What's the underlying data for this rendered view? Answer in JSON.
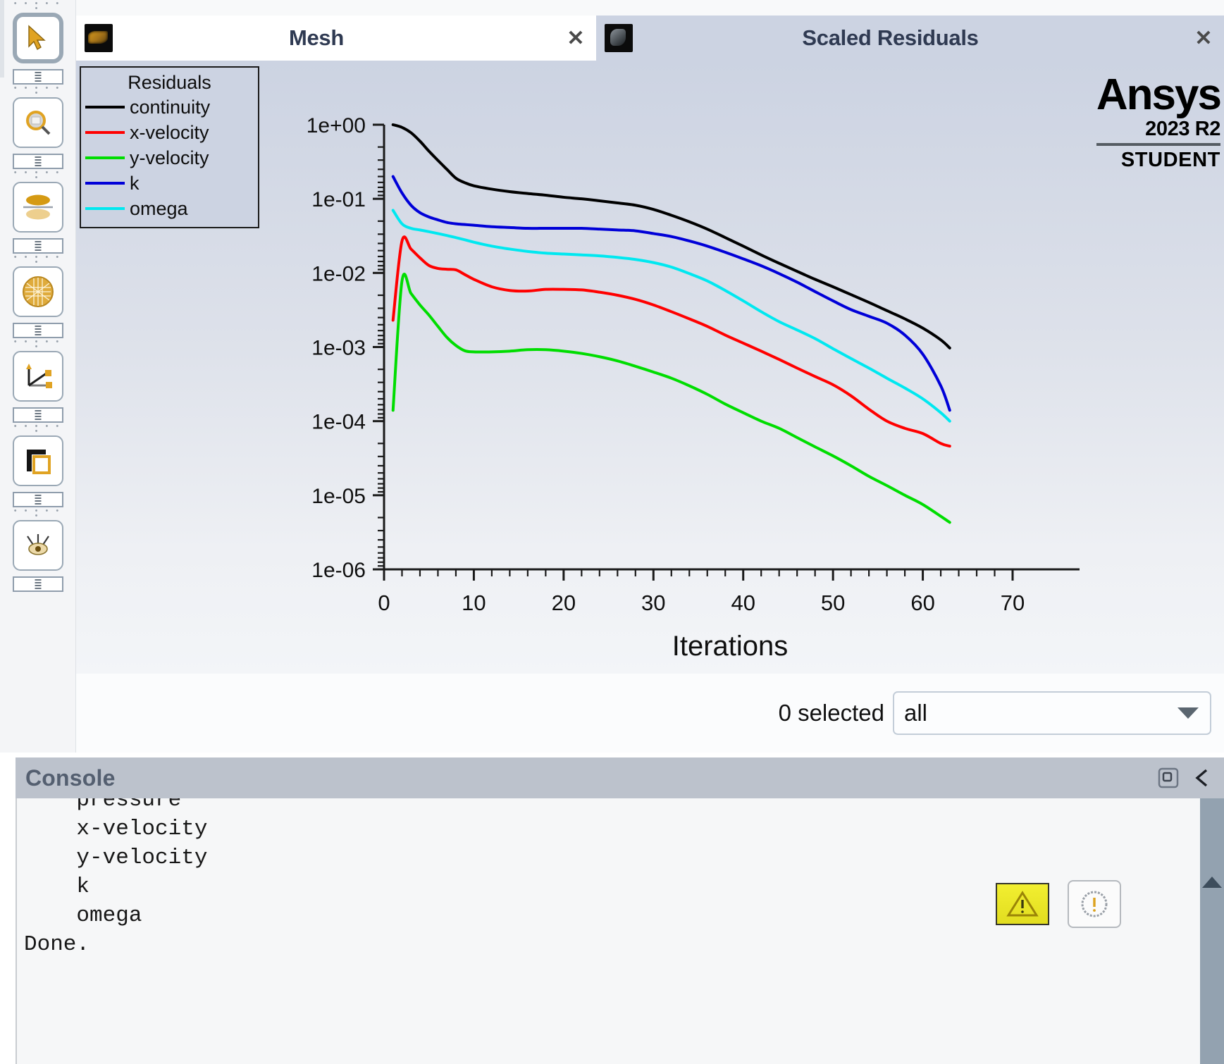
{
  "tabs": [
    {
      "label": "Mesh",
      "icon": "mesh-thumbnail-icon",
      "close_label": "✕",
      "active": false
    },
    {
      "label": "Scaled Residuals",
      "icon": "residuals-thumbnail-icon",
      "close_label": "✕",
      "active": true
    }
  ],
  "toolbar": {
    "items": [
      {
        "name": "select-cursor-tool",
        "icon": "cursor-arrow-icon"
      },
      {
        "name": "zoom-tool",
        "icon": "magnifier-icon"
      },
      {
        "name": "mirror-tool",
        "icon": "mirror-planes-icon"
      },
      {
        "name": "mesh-display-tool",
        "icon": "mesh-sphere-icon"
      },
      {
        "name": "axes-tool",
        "icon": "coordinate-axes-icon"
      },
      {
        "name": "copy-view-tool",
        "icon": "copy-layers-icon"
      },
      {
        "name": "view-tool",
        "icon": "eye-view-icon"
      }
    ]
  },
  "logo": {
    "brand": "Ansys",
    "version": "2023 R2",
    "edition": "STUDENT"
  },
  "legend": {
    "title": "Residuals",
    "entries": [
      {
        "label": "continuity",
        "color": "#000000"
      },
      {
        "label": "x-velocity",
        "color": "#ff0000"
      },
      {
        "label": "y-velocity",
        "color": "#00dd00"
      },
      {
        "label": "k",
        "color": "#0000d8"
      },
      {
        "label": "omega",
        "color": "#00e8f0"
      }
    ]
  },
  "selection": {
    "count_label": "0 selected",
    "value": "all",
    "arrow_icon": "chevron-down-icon"
  },
  "console": {
    "title": "Console",
    "popout_icon": "undock-window-icon",
    "collapse_icon": "chevron-left-icon",
    "warning_icon": "warning-triangle-icon",
    "info_icon": "info-circle-icon",
    "scroll_up_icon": "scroll-up-arrow-icon",
    "lines": [
      "    pressure",
      "    x-velocity",
      "    y-velocity",
      "    k",
      "    omega",
      "Done."
    ]
  },
  "chart_data": {
    "type": "line",
    "title": "Scaled Residuals",
    "xlabel": "Iterations",
    "ylabel": "",
    "yscale": "log",
    "xlim": [
      0,
      70
    ],
    "ylim": [
      1e-06,
      1
    ],
    "xticks": [
      0,
      10,
      20,
      30,
      40,
      50,
      60,
      70
    ],
    "yticks": [
      "1e+00",
      "1e-01",
      "1e-02",
      "1e-03",
      "1e-04",
      "1e-05",
      "1e-06"
    ],
    "grid": false,
    "legend_position": "top-left",
    "x": [
      1,
      2,
      3,
      4,
      5,
      6,
      7,
      8,
      9,
      10,
      12,
      14,
      16,
      18,
      20,
      22,
      24,
      26,
      28,
      30,
      32,
      34,
      36,
      38,
      40,
      42,
      44,
      46,
      48,
      50,
      52,
      54,
      56,
      58,
      60,
      62,
      63
    ],
    "series": [
      {
        "name": "continuity",
        "color": "#000000",
        "values": [
          1.0,
          0.92,
          0.78,
          0.6,
          0.44,
          0.33,
          0.25,
          0.19,
          0.165,
          0.15,
          0.135,
          0.125,
          0.118,
          0.112,
          0.105,
          0.1,
          0.094,
          0.088,
          0.082,
          0.072,
          0.06,
          0.049,
          0.039,
          0.03,
          0.023,
          0.0175,
          0.0135,
          0.0105,
          0.0082,
          0.0065,
          0.0051,
          0.004,
          0.0031,
          0.0024,
          0.0018,
          0.00125,
          0.00097
        ]
      },
      {
        "name": "x-velocity",
        "color": "#ff0000",
        "values": [
          0.0023,
          0.027,
          0.021,
          0.016,
          0.0126,
          0.0115,
          0.0112,
          0.011,
          0.0095,
          0.0082,
          0.0065,
          0.0058,
          0.0057,
          0.006,
          0.006,
          0.0059,
          0.0055,
          0.005,
          0.0044,
          0.0037,
          0.003,
          0.0024,
          0.0019,
          0.00145,
          0.00113,
          0.00088,
          0.00068,
          0.00052,
          0.0004,
          0.00031,
          0.00022,
          0.000145,
          0.0001,
          8e-05,
          6.8e-05,
          5e-05,
          4.6e-05
        ]
      },
      {
        "name": "y-velocity",
        "color": "#00dd00",
        "values": [
          0.00014,
          0.0078,
          0.0053,
          0.0037,
          0.0027,
          0.0019,
          0.00135,
          0.00105,
          0.00089,
          0.00086,
          0.00086,
          0.00088,
          0.00092,
          0.00092,
          0.00088,
          0.00082,
          0.00074,
          0.00065,
          0.00055,
          0.00046,
          0.00038,
          0.0003,
          0.00023,
          0.00017,
          0.00013,
          0.0001,
          8e-05,
          6e-05,
          4.5e-05,
          3.4e-05,
          2.5e-05,
          1.8e-05,
          1.35e-05,
          1e-05,
          7.5e-06,
          5.2e-06,
          4.3e-06
        ]
      },
      {
        "name": "k",
        "color": "#0000d8",
        "values": [
          0.2,
          0.12,
          0.082,
          0.065,
          0.057,
          0.052,
          0.048,
          0.046,
          0.045,
          0.044,
          0.042,
          0.041,
          0.04,
          0.04,
          0.04,
          0.04,
          0.039,
          0.038,
          0.037,
          0.034,
          0.031,
          0.027,
          0.023,
          0.019,
          0.0155,
          0.0125,
          0.0098,
          0.0075,
          0.0056,
          0.0042,
          0.0032,
          0.0026,
          0.0021,
          0.00145,
          0.0008,
          0.0003,
          0.00014
        ]
      },
      {
        "name": "omega",
        "color": "#00e8f0",
        "values": [
          0.07,
          0.046,
          0.04,
          0.038,
          0.036,
          0.034,
          0.032,
          0.03,
          0.028,
          0.026,
          0.023,
          0.021,
          0.0195,
          0.0185,
          0.018,
          0.0175,
          0.017,
          0.0162,
          0.0152,
          0.0138,
          0.012,
          0.0098,
          0.0078,
          0.0058,
          0.0042,
          0.003,
          0.0022,
          0.0017,
          0.0013,
          0.00095,
          0.0007,
          0.00052,
          0.00038,
          0.00028,
          0.0002,
          0.00013,
          0.0001
        ]
      }
    ]
  }
}
